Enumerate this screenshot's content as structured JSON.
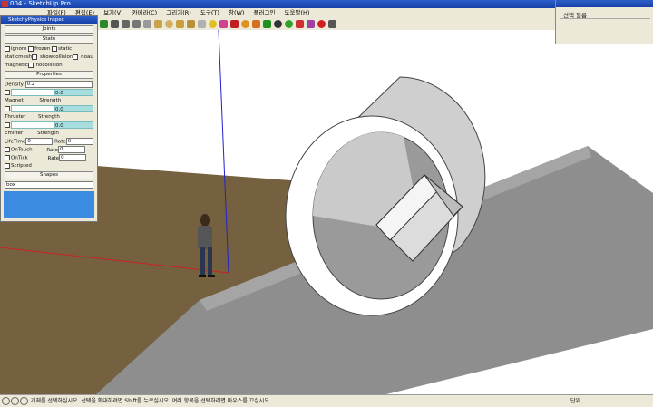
{
  "window": {
    "title": "004 - SketchUp Pro"
  },
  "menu": {
    "items": [
      "파일(F)",
      "편집(E)",
      "보기(V)",
      "카메라(C)",
      "그리기(R)",
      "도구(T)",
      "창(W)",
      "플러그인",
      "도움말(H)"
    ]
  },
  "toolbar": {
    "icons": [
      "play-icon",
      "rewind-icon",
      "pause-icon",
      "stop-icon",
      "settings-icon",
      "box-icon",
      "sphere-icon",
      "cylinder-icon",
      "cone-icon",
      "pipe-icon",
      "joint-icon",
      "hinge-icon",
      "line-icon",
      "servo-icon",
      "slider-icon",
      "spring-icon",
      "magnet-icon",
      "thruster-icon",
      "emitter-icon",
      "wand-icon",
      "record-icon",
      "stop-record-icon"
    ]
  },
  "physics_window": {
    "title": "SketchyPhysics Inspec",
    "sections": {
      "joints": "Joints",
      "state": "State",
      "properties": "Properties",
      "shapes": "Shapes"
    },
    "state_checks": [
      "ignore",
      "frozen",
      "static",
      "staticmesh",
      "showcollision",
      "noautofreeze",
      "magnetic",
      "nocollision"
    ],
    "density": {
      "label": "Density",
      "value": "0.2"
    },
    "magnet": {
      "label": "Magnet",
      "strength_label": "Strength",
      "value": "0.0"
    },
    "thruster": {
      "label": "Thruster",
      "strength_label": "Strength",
      "value": "0.0"
    },
    "emitter": {
      "label": "Emitter",
      "strength_label": "Strength",
      "value": "0.0"
    },
    "lifetime": {
      "label": "LifeTime",
      "value": "0",
      "rate_label": "Rate",
      "rate_value": "0"
    },
    "ontouch": {
      "label": "OnTouch",
      "rate_label": "Rate",
      "rate_value": "0"
    },
    "ontick": {
      "label": "OnTick",
      "rate_label": "Rate",
      "rate_value": "0"
    },
    "scripted": {
      "label": "Scripted"
    },
    "shape": {
      "value": "box"
    }
  },
  "right_panel": {
    "label": "선택 필름"
  },
  "status": {
    "text": "개체를 선택하십시오. 선택을 확대하려면 Shift를 누르십시오. 여러 항목을 선택하려면 마우스를 끄십시오.",
    "units_label": "단위"
  },
  "colors": {
    "ground": "#75613f",
    "sky": "#ffffff",
    "ramp": "#8e8e8e",
    "title_blue": "#2c5fc9",
    "axis_red": "#cc2222",
    "axis_blue": "#2222cc",
    "panel_blue": "#3b8be0"
  }
}
